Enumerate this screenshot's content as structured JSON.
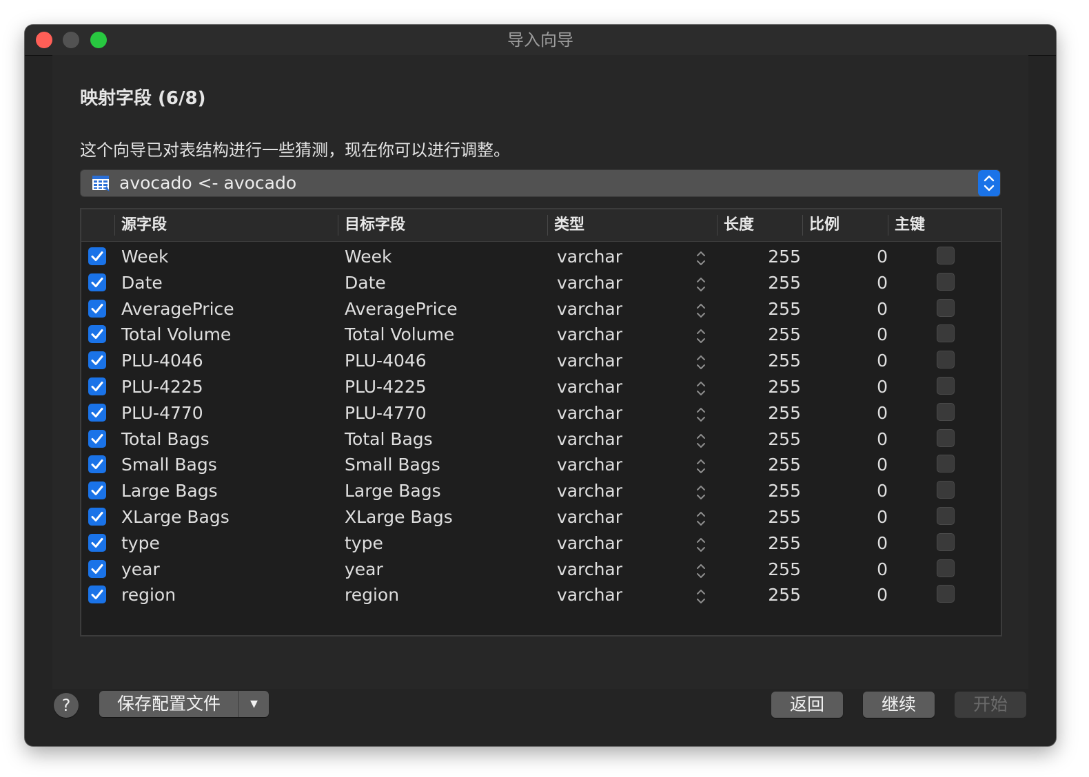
{
  "window": {
    "title": "导入向导"
  },
  "step": {
    "heading": "映射字段 (6/8)",
    "description": "这个向导已对表结构进行一些猜测，现在你可以进行调整。"
  },
  "table_selector": {
    "value": "avocado <- avocado",
    "icon": "table-icon"
  },
  "columns": {
    "source": "源字段",
    "target": "目标字段",
    "type": "类型",
    "length": "长度",
    "scale": "比例",
    "primary_key": "主键"
  },
  "rows": [
    {
      "source": "Week",
      "target": "Week",
      "type": "varchar",
      "length": "255",
      "scale": "0",
      "checked": true,
      "primary_key": false
    },
    {
      "source": "Date",
      "target": "Date",
      "type": "varchar",
      "length": "255",
      "scale": "0",
      "checked": true,
      "primary_key": false
    },
    {
      "source": "AveragePrice",
      "target": "AveragePrice",
      "type": "varchar",
      "length": "255",
      "scale": "0",
      "checked": true,
      "primary_key": false
    },
    {
      "source": "Total Volume",
      "target": "Total Volume",
      "type": "varchar",
      "length": "255",
      "scale": "0",
      "checked": true,
      "primary_key": false
    },
    {
      "source": "PLU-4046",
      "target": "PLU-4046",
      "type": "varchar",
      "length": "255",
      "scale": "0",
      "checked": true,
      "primary_key": false
    },
    {
      "source": "PLU-4225",
      "target": "PLU-4225",
      "type": "varchar",
      "length": "255",
      "scale": "0",
      "checked": true,
      "primary_key": false
    },
    {
      "source": "PLU-4770",
      "target": "PLU-4770",
      "type": "varchar",
      "length": "255",
      "scale": "0",
      "checked": true,
      "primary_key": false
    },
    {
      "source": "Total Bags",
      "target": "Total Bags",
      "type": "varchar",
      "length": "255",
      "scale": "0",
      "checked": true,
      "primary_key": false
    },
    {
      "source": "Small Bags",
      "target": "Small Bags",
      "type": "varchar",
      "length": "255",
      "scale": "0",
      "checked": true,
      "primary_key": false
    },
    {
      "source": "Large Bags",
      "target": "Large Bags",
      "type": "varchar",
      "length": "255",
      "scale": "0",
      "checked": true,
      "primary_key": false
    },
    {
      "source": "XLarge Bags",
      "target": "XLarge Bags",
      "type": "varchar",
      "length": "255",
      "scale": "0",
      "checked": true,
      "primary_key": false
    },
    {
      "source": "type",
      "target": "type",
      "type": "varchar",
      "length": "255",
      "scale": "0",
      "checked": true,
      "primary_key": false
    },
    {
      "source": "year",
      "target": "year",
      "type": "varchar",
      "length": "255",
      "scale": "0",
      "checked": true,
      "primary_key": false
    },
    {
      "source": "region",
      "target": "region",
      "type": "varchar",
      "length": "255",
      "scale": "0",
      "checked": true,
      "primary_key": false
    }
  ],
  "footer": {
    "help": "?",
    "save_profile": "保存配置文件",
    "back": "返回",
    "continue": "继续",
    "start": "开始"
  },
  "colors": {
    "accent": "#1a73e8",
    "window_bg": "#242424",
    "grid_bg": "#1e1e1e",
    "close": "#ff5f57",
    "maximize": "#28c840"
  }
}
